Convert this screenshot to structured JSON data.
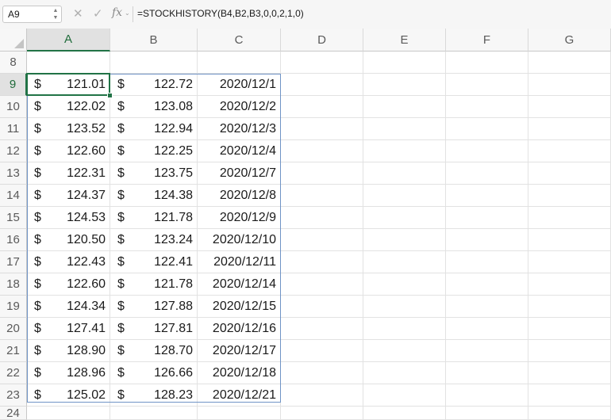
{
  "name_box": {
    "value": "A9"
  },
  "formula_bar": {
    "cancel_icon": "close-icon",
    "confirm_icon": "check-icon",
    "function_label": "fx",
    "formula": "=STOCKHISTORY(B4,B2,B3,0,0,2,1,0)"
  },
  "columns": [
    "A",
    "B",
    "C",
    "D",
    "E",
    "F",
    "G"
  ],
  "selected_column": "A",
  "selected_row": "9",
  "row_8": "8",
  "row_24": "24",
  "rows": [
    {
      "row": "9",
      "cur_a": "$",
      "a": "121.01",
      "cur_b": "$",
      "b": "122.72",
      "c": "2020/12/1"
    },
    {
      "row": "10",
      "cur_a": "$",
      "a": "122.02",
      "cur_b": "$",
      "b": "123.08",
      "c": "2020/12/2"
    },
    {
      "row": "11",
      "cur_a": "$",
      "a": "123.52",
      "cur_b": "$",
      "b": "122.94",
      "c": "2020/12/3"
    },
    {
      "row": "12",
      "cur_a": "$",
      "a": "122.60",
      "cur_b": "$",
      "b": "122.25",
      "c": "2020/12/4"
    },
    {
      "row": "13",
      "cur_a": "$",
      "a": "122.31",
      "cur_b": "$",
      "b": "123.75",
      "c": "2020/12/7"
    },
    {
      "row": "14",
      "cur_a": "$",
      "a": "124.37",
      "cur_b": "$",
      "b": "124.38",
      "c": "2020/12/8"
    },
    {
      "row": "15",
      "cur_a": "$",
      "a": "124.53",
      "cur_b": "$",
      "b": "121.78",
      "c": "2020/12/9"
    },
    {
      "row": "16",
      "cur_a": "$",
      "a": "120.50",
      "cur_b": "$",
      "b": "123.24",
      "c": "2020/12/10"
    },
    {
      "row": "17",
      "cur_a": "$",
      "a": "122.43",
      "cur_b": "$",
      "b": "122.41",
      "c": "2020/12/11"
    },
    {
      "row": "18",
      "cur_a": "$",
      "a": "122.60",
      "cur_b": "$",
      "b": "121.78",
      "c": "2020/12/14"
    },
    {
      "row": "19",
      "cur_a": "$",
      "a": "124.34",
      "cur_b": "$",
      "b": "127.88",
      "c": "2020/12/15"
    },
    {
      "row": "20",
      "cur_a": "$",
      "a": "127.41",
      "cur_b": "$",
      "b": "127.81",
      "c": "2020/12/16"
    },
    {
      "row": "21",
      "cur_a": "$",
      "a": "128.90",
      "cur_b": "$",
      "b": "128.70",
      "c": "2020/12/17"
    },
    {
      "row": "22",
      "cur_a": "$",
      "a": "128.96",
      "cur_b": "$",
      "b": "126.66",
      "c": "2020/12/18"
    },
    {
      "row": "23",
      "cur_a": "$",
      "a": "125.02",
      "cur_b": "$",
      "b": "128.23",
      "c": "2020/12/21"
    }
  ]
}
